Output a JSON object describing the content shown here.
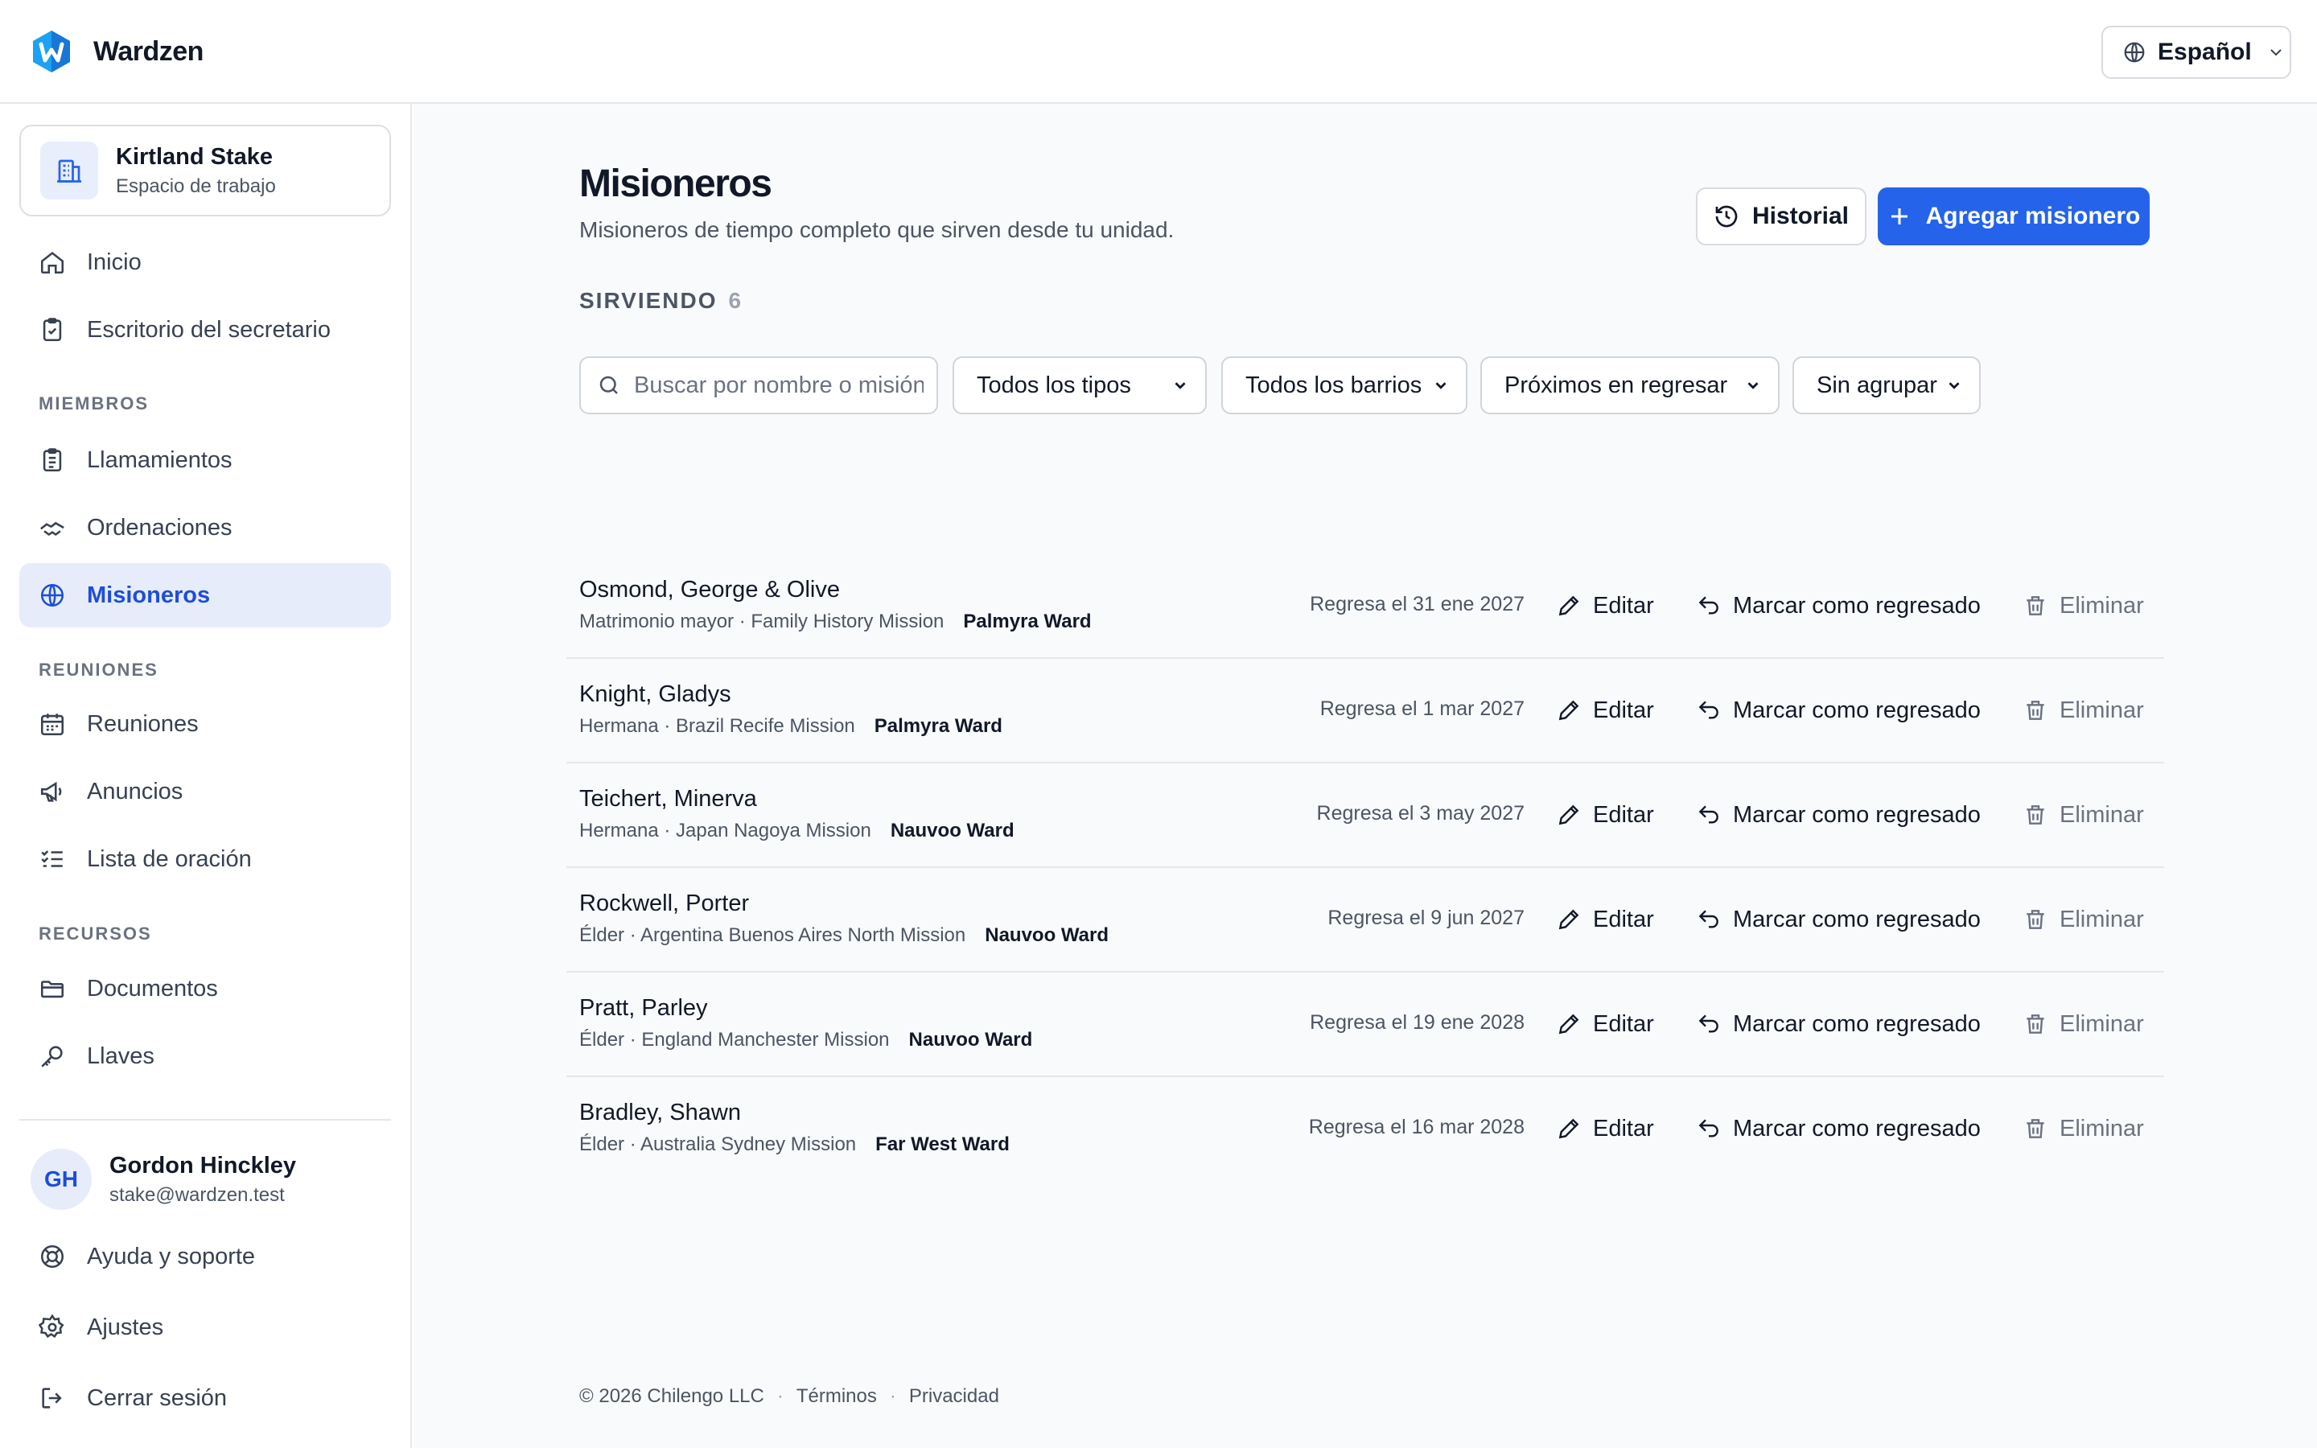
{
  "app": {
    "name": "Wardzen",
    "language": "Español"
  },
  "workspace": {
    "title": "Kirtland Stake",
    "subtitle": "Espacio de trabajo"
  },
  "sidebar": {
    "items_top": [
      {
        "label": "Inicio",
        "icon": "home-icon"
      },
      {
        "label": "Escritorio del secretario",
        "icon": "clipboard-check-icon"
      }
    ],
    "sections": [
      {
        "label": "MIEMBROS",
        "items": [
          {
            "label": "Llamamientos",
            "icon": "clipboard-list-icon"
          },
          {
            "label": "Ordenaciones",
            "icon": "handshake-icon"
          },
          {
            "label": "Misioneros",
            "icon": "globe-icon",
            "active": true
          }
        ]
      },
      {
        "label": "REUNIONES",
        "items": [
          {
            "label": "Reuniones",
            "icon": "calendar-icon"
          },
          {
            "label": "Anuncios",
            "icon": "megaphone-icon"
          },
          {
            "label": "Lista de oración",
            "icon": "checklist-icon"
          }
        ]
      },
      {
        "label": "RECURSOS",
        "items": [
          {
            "label": "Documentos",
            "icon": "folder-icon"
          },
          {
            "label": "Llaves",
            "icon": "key-icon"
          }
        ]
      }
    ],
    "user": {
      "initials": "GH",
      "name": "Gordon Hinckley",
      "email": "stake@wardzen.test"
    },
    "items_bottom": [
      {
        "label": "Ayuda y soporte",
        "icon": "lifebuoy-icon"
      },
      {
        "label": "Ajustes",
        "icon": "gear-icon"
      },
      {
        "label": "Cerrar sesión",
        "icon": "logout-icon"
      }
    ]
  },
  "main": {
    "title": "Misioneros",
    "subtitle": "Misioneros de tiempo completo que sirven desde tu unidad.",
    "history_label": "Historial",
    "add_label": "Agregar misionero",
    "serving_label": "SIRVIENDO",
    "serving_count": "6",
    "search": {
      "placeholder": "Buscar por nombre o misión",
      "value": ""
    },
    "filters": {
      "type": "Todos los tipos",
      "ward": "Todos los barrios",
      "sort": "Próximos en regresar",
      "group": "Sin agrupar"
    },
    "actions": {
      "edit": "Editar",
      "mark_returned": "Marcar como regresado",
      "delete": "Eliminar"
    },
    "missionaries": [
      {
        "name": "Osmond, George & Olive",
        "meta": "Matrimonio mayor · Family History Mission",
        "ward": "Palmyra Ward",
        "return": "Regresa el 31 ene 2027"
      },
      {
        "name": "Knight, Gladys",
        "meta": "Hermana · Brazil Recife Mission",
        "ward": "Palmyra Ward",
        "return": "Regresa el 1 mar 2027"
      },
      {
        "name": "Teichert, Minerva",
        "meta": "Hermana · Japan Nagoya Mission",
        "ward": "Nauvoo Ward",
        "return": "Regresa el 3 may 2027"
      },
      {
        "name": "Rockwell, Porter",
        "meta": "Élder · Argentina Buenos Aires North Mission",
        "ward": "Nauvoo Ward",
        "return": "Regresa el 9 jun 2027"
      },
      {
        "name": "Pratt, Parley",
        "meta": "Élder · England Manchester Mission",
        "ward": "Nauvoo Ward",
        "return": "Regresa el 19 ene 2028"
      },
      {
        "name": "Bradley, Shawn",
        "meta": "Élder · Australia Sydney Mission",
        "ward": "Far West Ward",
        "return": "Regresa el 16 mar 2028"
      }
    ]
  },
  "footer": {
    "copyright": "© 2026 Chilengo LLC",
    "terms": "Términos",
    "privacy": "Privacidad"
  },
  "colors": {
    "accent": "#2563eb",
    "active_bg": "#e6ecfa",
    "active_text": "#1d4ed8"
  }
}
